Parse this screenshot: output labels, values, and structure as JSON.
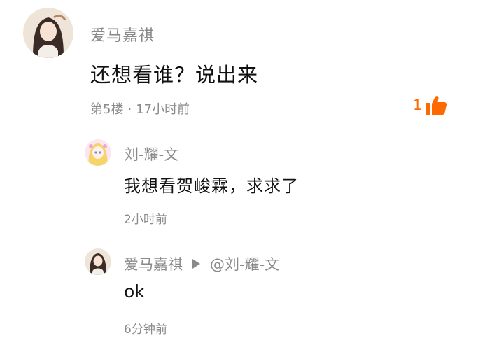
{
  "comment": {
    "author": "爱马嘉祺",
    "content": "还想看谁？说出来",
    "floor": "第5楼",
    "time": "17小时前",
    "likes": "1",
    "accent_color": "#ff6a00"
  },
  "replies": [
    {
      "author": "刘-耀-文",
      "content": "我想看贺峻霖，求求了",
      "time": "2小时前"
    },
    {
      "author": "爱马嘉祺",
      "reply_to": "@刘-耀-文",
      "content": "ok",
      "time": "6分钟前"
    }
  ]
}
